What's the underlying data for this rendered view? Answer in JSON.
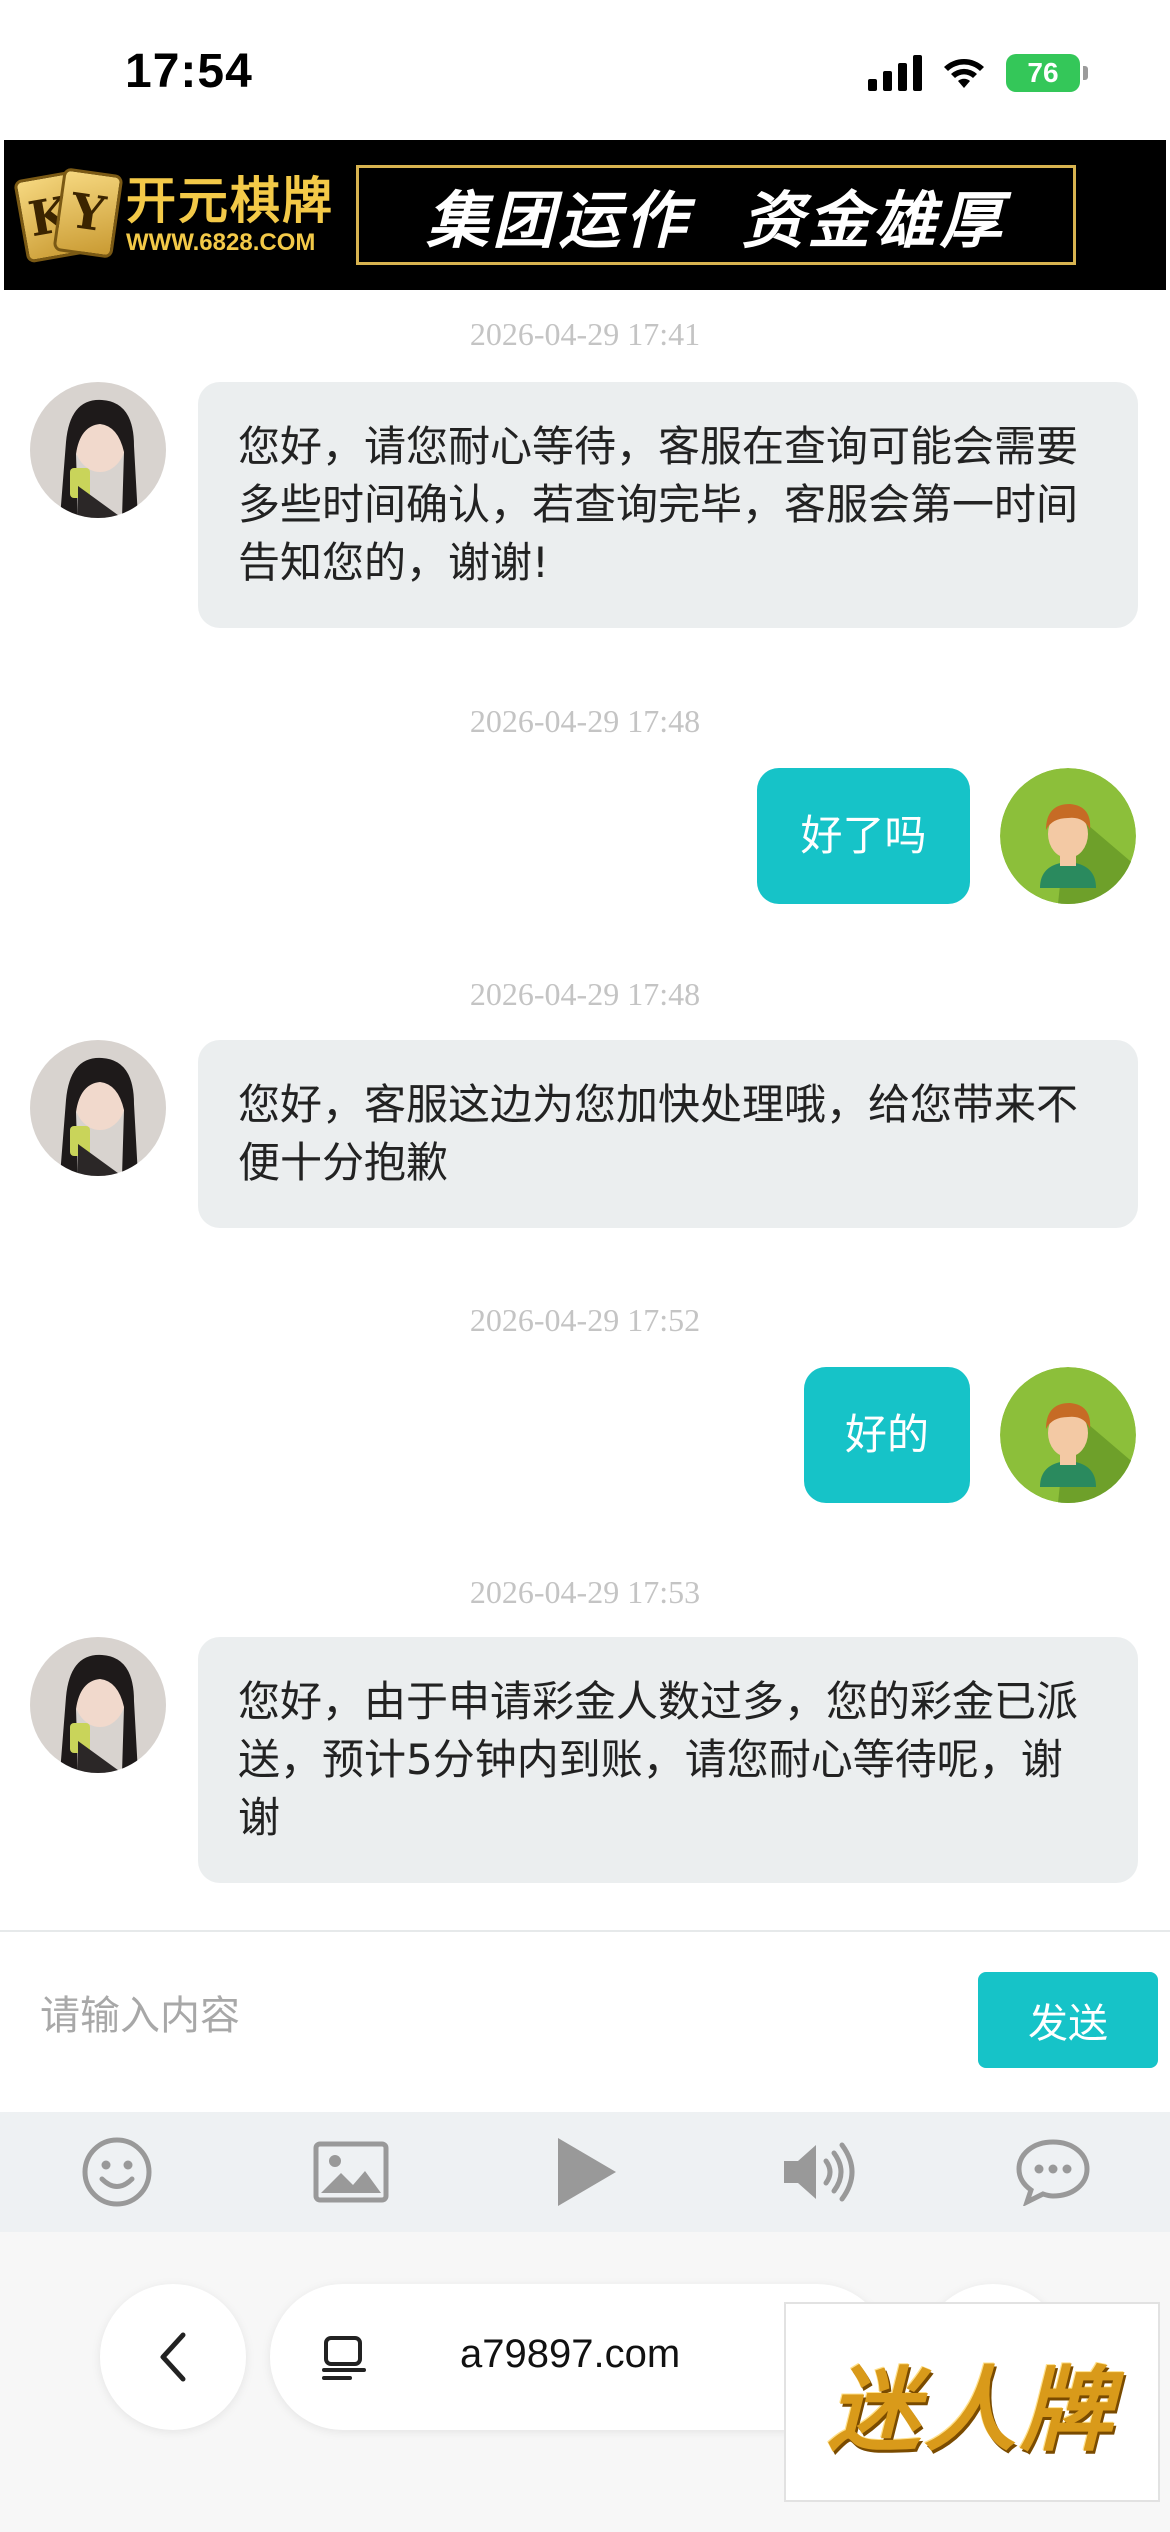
{
  "status_bar": {
    "time": "17:54",
    "battery": "76"
  },
  "banner": {
    "logo_initials": [
      "K",
      "Y"
    ],
    "logo_name": "开元棋牌",
    "logo_url": "WWW.6828.COM",
    "slogan": "集团运作  资金雄厚"
  },
  "chat": {
    "messages": [
      {
        "sender": "agent",
        "timestamp": "2026-04-29 17:41",
        "text": "您好，请您耐心等待，客服在查询可能会需要多些时间确认，若查询完毕，客服会第一时间告知您的，谢谢!"
      },
      {
        "sender": "user",
        "timestamp": "2026-04-29 17:48",
        "text": "好了吗"
      },
      {
        "sender": "agent",
        "timestamp": "2026-04-29 17:48",
        "text": "您好，客服这边为您加快处理哦，给您带来不便十分抱歉"
      },
      {
        "sender": "user",
        "timestamp": "2026-04-29 17:52",
        "text": "好的"
      },
      {
        "sender": "agent",
        "timestamp": "2026-04-29 17:53",
        "text": "您好，由于申请彩金人数过多，您的彩金已派送，预计5分钟内到账，请您耐心等待呢，谢谢"
      }
    ]
  },
  "composer": {
    "placeholder": "请输入内容",
    "value": "",
    "send_label": "发送"
  },
  "toolbar": {
    "icons": [
      "emoji-icon",
      "image-icon",
      "play-icon",
      "speaker-icon",
      "chat-bubble-icon"
    ]
  },
  "browser": {
    "url": "a79897.com"
  },
  "overlay": {
    "brand_text": "迷人牌"
  },
  "colors": {
    "accent": "#16c3c8",
    "agent_bubble": "#ebeeef",
    "banner_gold": "#f3c948"
  }
}
